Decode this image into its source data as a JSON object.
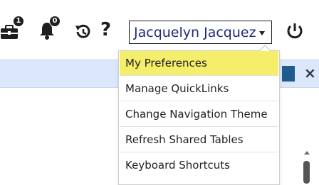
{
  "toolbar": {
    "briefcase_badge": "1",
    "notifications_badge": "0",
    "help_label": "?",
    "user_name": "Jacquelyn Jacquez"
  },
  "user_menu": {
    "items": [
      {
        "label": "My Preferences",
        "highlighted": true
      },
      {
        "label": "Manage QuickLinks"
      },
      {
        "label": "Change Navigation Theme"
      },
      {
        "label": "Refresh Shared Tables"
      },
      {
        "label": "Keyboard Shortcuts"
      }
    ]
  },
  "banner": {
    "close_label": "×"
  },
  "colors": {
    "highlight": "#f5ee6b",
    "user_name": "#1e2a78",
    "banner_bg": "#dbe7fb",
    "banner_button": "#1f5b8f"
  },
  "icons": [
    "briefcase-icon",
    "bell-icon",
    "history-icon",
    "help-icon",
    "chevron-down-icon",
    "power-icon",
    "close-icon"
  ]
}
